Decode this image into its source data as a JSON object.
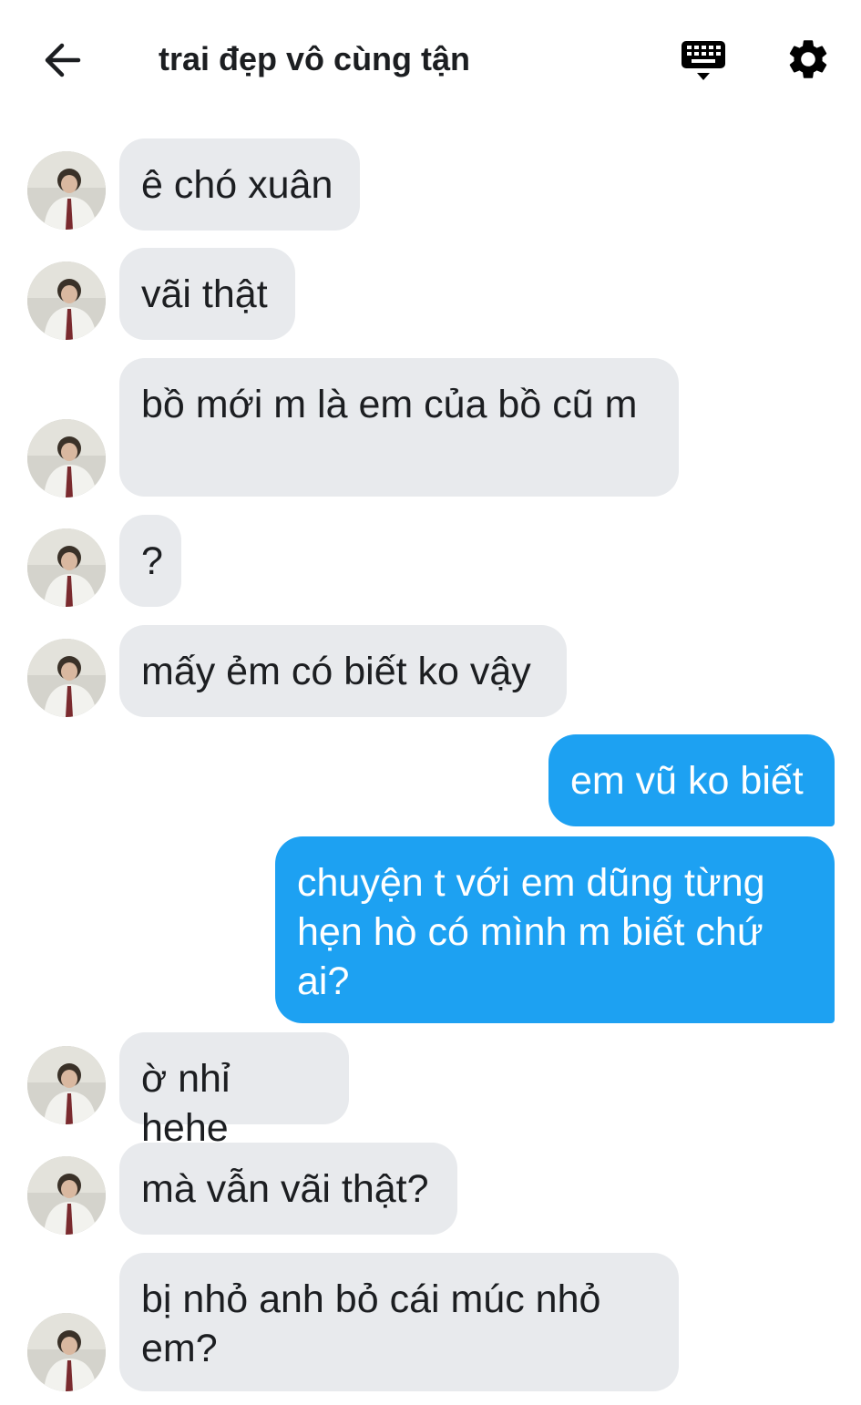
{
  "header": {
    "title": "trai đẹp vô cùng tận",
    "back_icon": "arrow-left-icon",
    "keyboard_icon": "keyboard-icon",
    "settings_icon": "gear-icon"
  },
  "colors": {
    "incoming_bubble": "#e8eaed",
    "outgoing_bubble": "#1da1f2",
    "outgoing_text": "#ffffff",
    "text": "#1c1e21"
  },
  "messages": [
    {
      "direction": "in",
      "text": "ê chó xuân"
    },
    {
      "direction": "in",
      "text": "vãi thật"
    },
    {
      "direction": "in",
      "text": "bồ mới m là em của bồ cũ m"
    },
    {
      "direction": "in",
      "text": "?"
    },
    {
      "direction": "in",
      "text": "mấy ẻm có biết ko vậy"
    },
    {
      "direction": "out",
      "text": "em vũ ko biết"
    },
    {
      "direction": "out",
      "text": "chuyện t với em dũng từng hẹn hò có mình m biết chứ ai?"
    },
    {
      "direction": "in",
      "text": "ờ nhỉ hehe"
    },
    {
      "direction": "in",
      "text": "mà vẫn vãi thật?"
    },
    {
      "direction": "in",
      "text": "bị nhỏ anh bỏ cái múc nhỏ em?"
    }
  ]
}
